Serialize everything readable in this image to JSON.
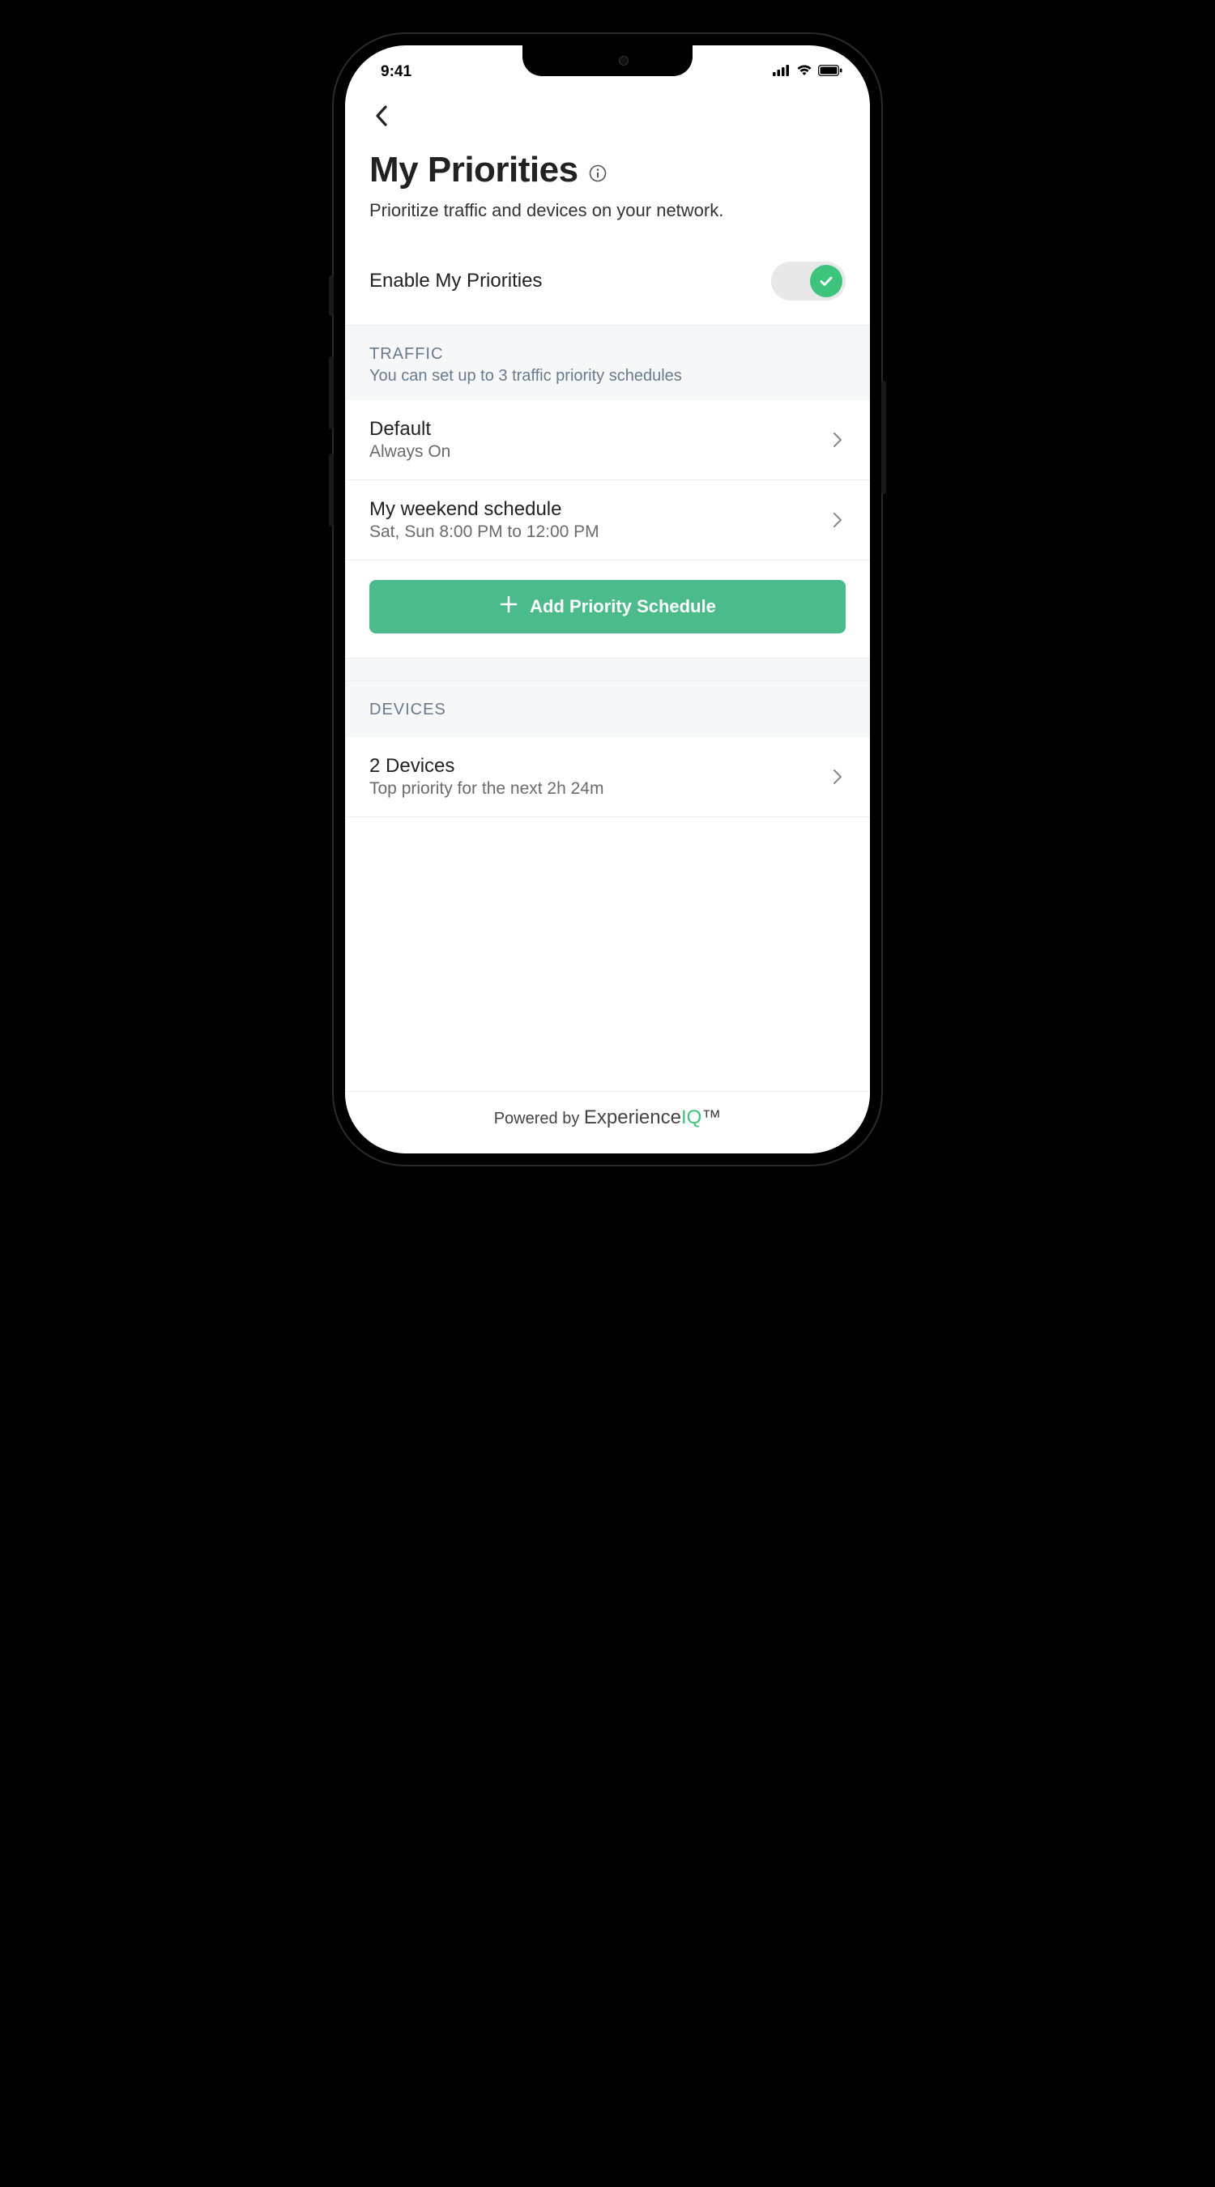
{
  "status": {
    "time": "9:41"
  },
  "header": {
    "title": "My Priorities",
    "subtitle": "Prioritize traffic and devices on your network."
  },
  "enable": {
    "label": "Enable My Priorities",
    "on": true
  },
  "traffic": {
    "title": "TRAFFIC",
    "subtitle": "You can set up to 3 traffic priority schedules",
    "items": [
      {
        "title": "Default",
        "sub": "Always On"
      },
      {
        "title": "My weekend schedule",
        "sub": "Sat, Sun 8:00 PM to 12:00 PM"
      }
    ],
    "add_label": "Add Priority Schedule"
  },
  "devices": {
    "title": "DEVICES",
    "row_title": "2 Devices",
    "row_sub": "Top priority for the next 2h 24m"
  },
  "footer": {
    "prefix": "Powered by ",
    "brand_exp": "Experience",
    "brand_iq": "IQ",
    "tm": "™"
  }
}
